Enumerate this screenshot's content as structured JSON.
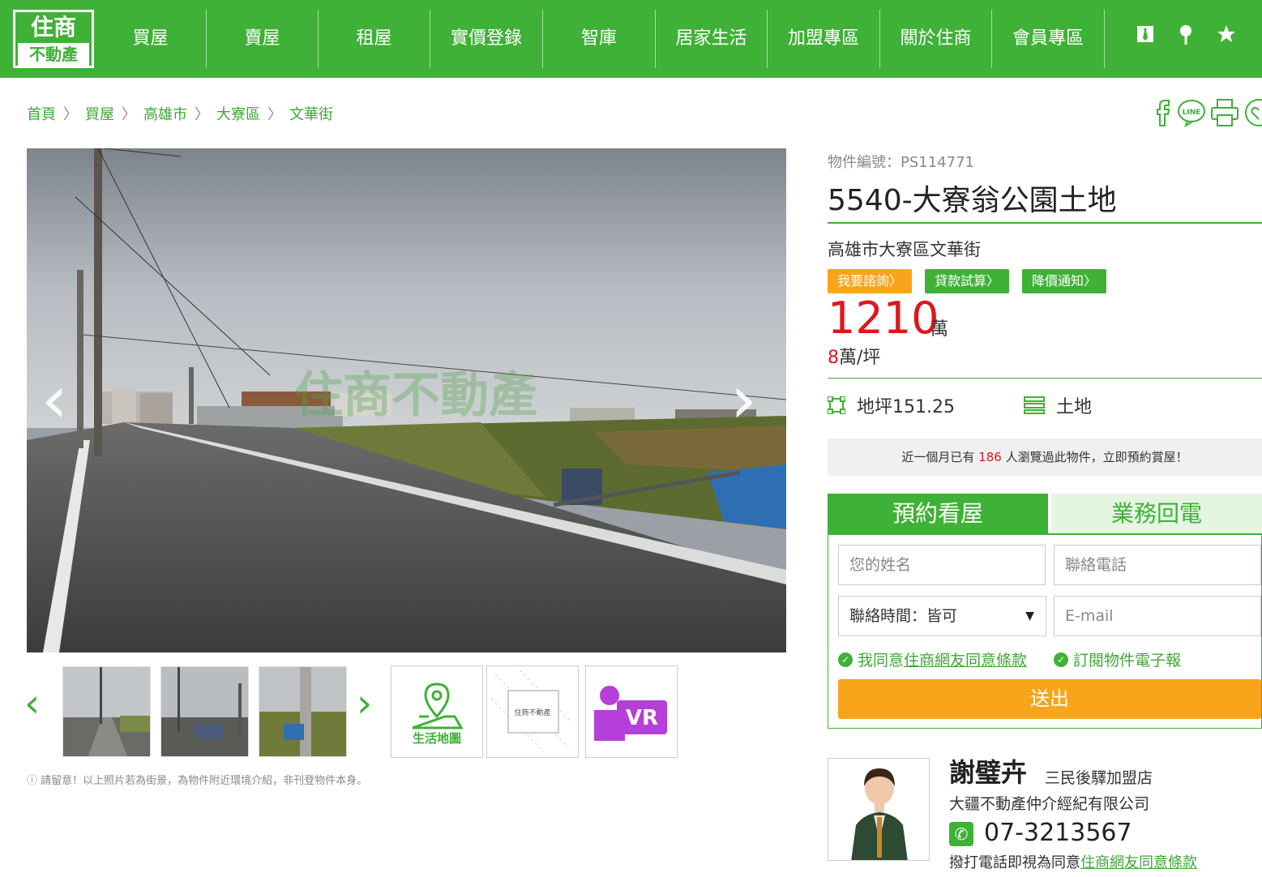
{
  "logo": {
    "line1": "住商",
    "line2": "不動產"
  },
  "nav": {
    "items": [
      {
        "label": "買屋"
      },
      {
        "label": "賣屋"
      },
      {
        "label": "租屋"
      },
      {
        "label": "實價登錄"
      },
      {
        "label": "智庫"
      },
      {
        "label": "居家生活"
      },
      {
        "label": "加盟專區"
      },
      {
        "label": "關於住商"
      },
      {
        "label": "會員專區"
      }
    ],
    "icons": [
      "tie-icon",
      "location-pin-icon",
      "star-icon",
      "user-icon"
    ]
  },
  "breadcrumb": [
    "首頁",
    "買屋",
    "高雄市",
    "大寮區",
    "文華街"
  ],
  "share_icons": [
    "facebook-icon",
    "line-icon",
    "print-icon",
    "favorite-icon"
  ],
  "photo": {
    "watermark": "住商不動產",
    "prev": "‹",
    "next": "›"
  },
  "thumbs": {
    "prev": "‹",
    "next": "›",
    "map_label": "生活地圖",
    "vr_label": "VR",
    "watermark": "住商不動產"
  },
  "notice": "請留意！以上照片若為街景，為物件附近環境介紹，非刊登物件本身。",
  "listing": {
    "id_label": "物件編號：PS114771",
    "title": "5540-大寮翁公園土地",
    "address": "高雄市大寮區文華街",
    "buttons": {
      "inquiry": "我要諮詢〉",
      "loan": "貸款試算〉",
      "price_alert": "降價通知〉"
    },
    "price": "1210",
    "price_unit": "萬",
    "unit_price_num": "8",
    "unit_price_unit": "萬/坪",
    "area_label": "地坪151.25",
    "type_label": "土地",
    "views_prefix": "近一個月已有",
    "views_count": "186",
    "views_suffix": "人瀏覽過此物件，立即預約賞屋！"
  },
  "form": {
    "tab_active": "預約看屋",
    "tab_inactive": "業務回電",
    "name_placeholder": "您的姓名",
    "phone_placeholder": "聯絡電話",
    "time_value": "聯絡時間：皆可",
    "email_placeholder": "E-mail",
    "agree_prefix": "我同意",
    "agree_link": "住商網友同意條款",
    "subscribe": "訂閱物件電子報",
    "submit": "送出"
  },
  "agent": {
    "name": "謝璧卉",
    "store": "三民後驛加盟店",
    "company": "大疆不動產仲介經紀有限公司",
    "phone": "07-3213567",
    "note_prefix": "撥打電話即視為同意",
    "note_link": "住商網友同意條款"
  },
  "colors": {
    "brand_green": "#3fb136",
    "price_red": "#e0161c",
    "orange": "#f9a51a",
    "vr_purple": "#b53fd9"
  }
}
